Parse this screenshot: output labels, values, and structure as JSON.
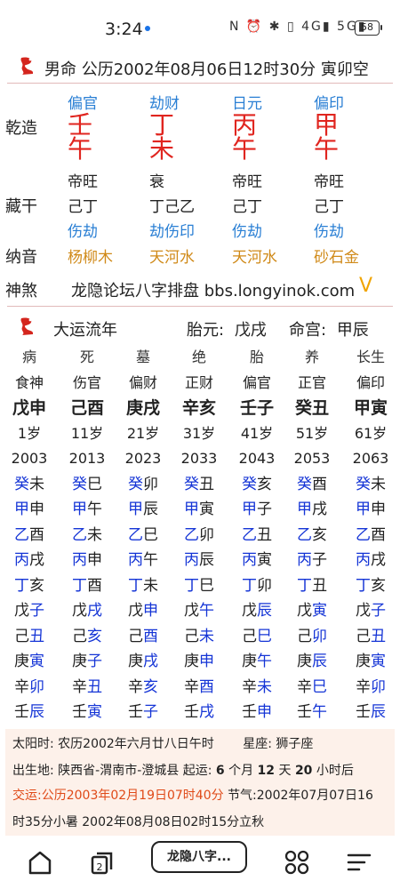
{
  "status": {
    "time": "3:24",
    "icons": "N ⏰ ✱ ▯ 4G▮ 5G▮",
    "battery": "58"
  },
  "header": {
    "title": "男命 公历2002年08月06日12时30分 寅卯空"
  },
  "pillars": {
    "label_qianzao": "乾造",
    "label_canggan": "藏干",
    "label_nayin": "纳音",
    "label_shensha": "神煞",
    "cols": [
      {
        "shishen": "偏官",
        "gan": "壬",
        "zhi": "午",
        "state": "帝旺",
        "canggan": "己丁",
        "canggan_ss": "伤劫",
        "nayin": "杨柳木"
      },
      {
        "shishen": "劫财",
        "gan": "丁",
        "zhi": "未",
        "state": "衰",
        "canggan": "丁己乙",
        "canggan_ss": "劫伤印",
        "nayin": "天河水"
      },
      {
        "shishen": "日元",
        "gan": "丙",
        "zhi": "午",
        "state": "帝旺",
        "canggan": "己丁",
        "canggan_ss": "伤劫",
        "nayin": "天河水"
      },
      {
        "shishen": "偏印",
        "gan": "甲",
        "zhi": "午",
        "state": "帝旺",
        "canggan": "己丁",
        "canggan_ss": "伤劫",
        "nayin": "砂石金"
      }
    ],
    "shensha_text": "龙隐论坛八字排盘 bbs.longyinok.com",
    "shensha_mark": "V"
  },
  "dayun": {
    "title": "大运流年",
    "taiyuan_label": "胎元:",
    "taiyuan": "戊戌",
    "minggong_label": "命宫:",
    "minggong": "甲辰",
    "columns": [
      {
        "state": "病",
        "shishen": "食神",
        "ganzhi": "戊申",
        "age": "1岁",
        "year": "2003",
        "rows": [
          [
            "癸",
            "未"
          ],
          [
            "甲",
            "申"
          ],
          [
            "乙",
            "酉"
          ],
          [
            "丙",
            "戌"
          ],
          [
            "丁",
            "亥"
          ],
          [
            "戊",
            "子"
          ],
          [
            "己",
            "丑"
          ],
          [
            "庚",
            "寅"
          ],
          [
            "辛",
            "卯"
          ],
          [
            "壬",
            "辰"
          ]
        ]
      },
      {
        "state": "死",
        "shishen": "伤官",
        "ganzhi": "己酉",
        "age": "11岁",
        "year": "2013",
        "rows": [
          [
            "癸",
            "巳"
          ],
          [
            "甲",
            "午"
          ],
          [
            "乙",
            "未"
          ],
          [
            "丙",
            "申"
          ],
          [
            "丁",
            "酉"
          ],
          [
            "戊",
            "戌"
          ],
          [
            "己",
            "亥"
          ],
          [
            "庚",
            "子"
          ],
          [
            "辛",
            "丑"
          ],
          [
            "壬",
            "寅"
          ]
        ]
      },
      {
        "state": "墓",
        "shishen": "偏财",
        "ganzhi": "庚戌",
        "age": "21岁",
        "year": "2023",
        "rows": [
          [
            "癸",
            "卯"
          ],
          [
            "甲",
            "辰"
          ],
          [
            "乙",
            "巳"
          ],
          [
            "丙",
            "午"
          ],
          [
            "丁",
            "未"
          ],
          [
            "戊",
            "申"
          ],
          [
            "己",
            "酉"
          ],
          [
            "庚",
            "戌"
          ],
          [
            "辛",
            "亥"
          ],
          [
            "壬",
            "子"
          ]
        ]
      },
      {
        "state": "绝",
        "shishen": "正财",
        "ganzhi": "辛亥",
        "age": "31岁",
        "year": "2033",
        "rows": [
          [
            "癸",
            "丑"
          ],
          [
            "甲",
            "寅"
          ],
          [
            "乙",
            "卯"
          ],
          [
            "丙",
            "辰"
          ],
          [
            "丁",
            "巳"
          ],
          [
            "戊",
            "午"
          ],
          [
            "己",
            "未"
          ],
          [
            "庚",
            "申"
          ],
          [
            "辛",
            "酉"
          ],
          [
            "壬",
            "戌"
          ]
        ]
      },
      {
        "state": "胎",
        "shishen": "偏官",
        "ganzhi": "壬子",
        "age": "41岁",
        "year": "2043",
        "rows": [
          [
            "癸",
            "亥"
          ],
          [
            "甲",
            "子"
          ],
          [
            "乙",
            "丑"
          ],
          [
            "丙",
            "寅"
          ],
          [
            "丁",
            "卯"
          ],
          [
            "戊",
            "辰"
          ],
          [
            "己",
            "巳"
          ],
          [
            "庚",
            "午"
          ],
          [
            "辛",
            "未"
          ],
          [
            "壬",
            "申"
          ]
        ]
      },
      {
        "state": "养",
        "shishen": "正官",
        "ganzhi": "癸丑",
        "age": "51岁",
        "year": "2053",
        "rows": [
          [
            "癸",
            "酉"
          ],
          [
            "甲",
            "戌"
          ],
          [
            "乙",
            "亥"
          ],
          [
            "丙",
            "子"
          ],
          [
            "丁",
            "丑"
          ],
          [
            "戊",
            "寅"
          ],
          [
            "己",
            "卯"
          ],
          [
            "庚",
            "辰"
          ],
          [
            "辛",
            "巳"
          ],
          [
            "壬",
            "午"
          ]
        ]
      },
      {
        "state": "长生",
        "shishen": "偏印",
        "ganzhi": "甲寅",
        "age": "61岁",
        "year": "2063",
        "rows": [
          [
            "癸",
            "未"
          ],
          [
            "甲",
            "申"
          ],
          [
            "乙",
            "酉"
          ],
          [
            "丙",
            "戌"
          ],
          [
            "丁",
            "亥"
          ],
          [
            "戊",
            "子"
          ],
          [
            "己",
            "丑"
          ],
          [
            "庚",
            "寅"
          ],
          [
            "辛",
            "卯"
          ],
          [
            "壬",
            "辰"
          ]
        ]
      }
    ]
  },
  "info": {
    "line1_a": "太阳时: 农历2002年六月廿八日午时",
    "line1_b": "星座: 狮子座",
    "line2_a": "出生地: 陕西省-渭南市-澄城县 起运:",
    "line2_m": "6",
    "line2_b": "个月",
    "line2_d": "12",
    "line2_c": "天",
    "line2_h": "20",
    "line2_e": "小时后",
    "line3_a": "交运:公历2003年02月19日07时40分",
    "line3_b": "节气:2002年07月07日16",
    "line4": "时35分小暑 2002年08月08日02时15分立秋"
  },
  "nav": {
    "tab_label": "龙隐八字..."
  }
}
